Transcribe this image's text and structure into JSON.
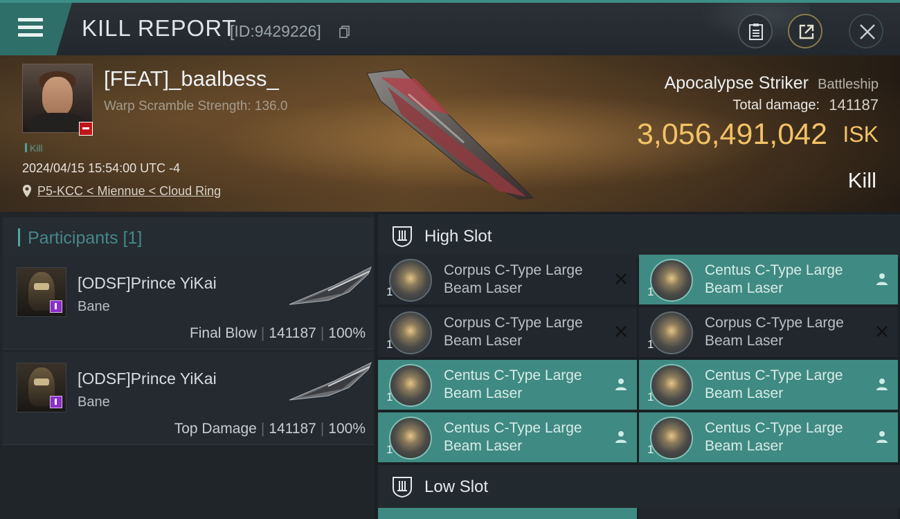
{
  "header": {
    "title": "KILL REPORT",
    "report_id": "[ID:9429226]",
    "icons": [
      "menu-icon",
      "copy-icon",
      "clipboard-icon",
      "share-icon",
      "close-icon"
    ]
  },
  "victim": {
    "name": "[FEAT]_baalbess_",
    "warp_scramble": "Warp Scramble Strength: 136.0",
    "kill_tag": "Kill",
    "datetime": "2024/04/15 15:54:00 UTC -4",
    "location": "P5-KCC < Miennue < Cloud Ring"
  },
  "ship": {
    "name": "Apocalypse Striker",
    "class": "Battleship",
    "damage_label": "Total damage:",
    "damage_value": "141187",
    "isk_value": "3,056,491,042",
    "isk_unit": "ISK",
    "result": "Kill"
  },
  "participants": {
    "title": "Participants [1]",
    "items": [
      {
        "name": "[ODSF]Prince YiKai",
        "ship": "Bane",
        "role": "Final Blow",
        "damage": "141187",
        "percent": "100%"
      },
      {
        "name": "[ODSF]Prince YiKai",
        "ship": "Bane",
        "role": "Top Damage",
        "damage": "141187",
        "percent": "100%"
      }
    ]
  },
  "slots": {
    "high_title": "High Slot",
    "low_title": "Low Slot",
    "high_modules": [
      {
        "line1": "Corpus C-Type Large",
        "line2": "Beam Laser",
        "qty": "1",
        "status": "destroyed",
        "status_icon": "x-icon"
      },
      {
        "line1": "Centus C-Type Large",
        "line2": "Beam Laser",
        "qty": "1",
        "status": "dropped",
        "status_icon": "person-icon"
      },
      {
        "line1": "Corpus C-Type Large",
        "line2": "Beam Laser",
        "qty": "1",
        "status": "destroyed",
        "status_icon": "x-icon"
      },
      {
        "line1": "Corpus C-Type Large",
        "line2": "Beam Laser",
        "qty": "1",
        "status": "destroyed",
        "status_icon": "x-icon"
      },
      {
        "line1": "Centus C-Type Large",
        "line2": "Beam Laser",
        "qty": "1",
        "status": "dropped",
        "status_icon": "person-icon"
      },
      {
        "line1": "Centus C-Type Large",
        "line2": "Beam Laser",
        "qty": "1",
        "status": "dropped",
        "status_icon": "person-icon"
      },
      {
        "line1": "Centus C-Type Large",
        "line2": "Beam Laser",
        "qty": "1",
        "status": "dropped",
        "status_icon": "person-icon"
      },
      {
        "line1": "Centus C-Type Large",
        "line2": "Beam Laser",
        "qty": "1",
        "status": "dropped",
        "status_icon": "person-icon"
      }
    ]
  },
  "colors": {
    "accent_teal": "#3f8a82",
    "isk_gold": "#f2c266",
    "danger_red": "#c0161b",
    "badge_purple": "#8b2fc9"
  }
}
